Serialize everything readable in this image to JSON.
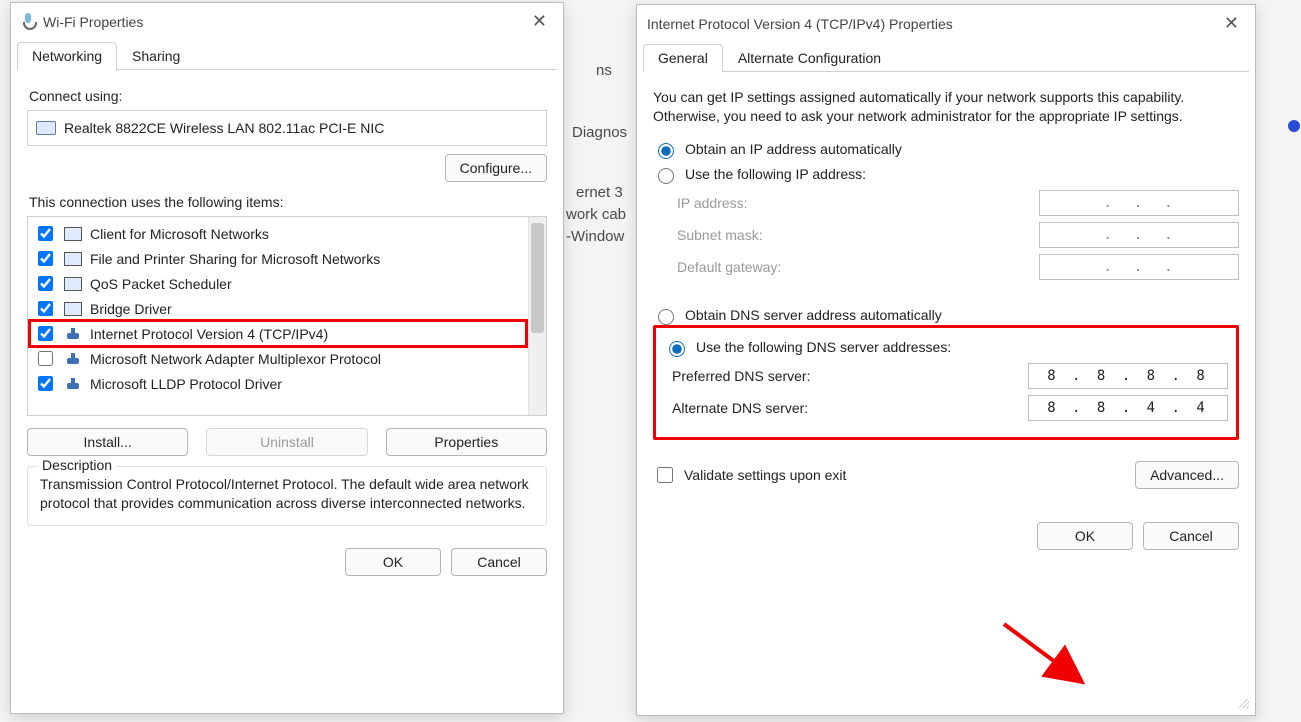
{
  "background": {
    "frag1": "ns",
    "frag2": "Diagnos",
    "frag3": "ernet 3",
    "frag4": "work cab",
    "frag5": "-Window"
  },
  "wifi": {
    "title": "Wi-Fi Properties",
    "tabs": {
      "networking": "Networking",
      "sharing": "Sharing"
    },
    "connect_using": "Connect using:",
    "adapter": "Realtek 8822CE Wireless LAN 802.11ac PCI-E NIC",
    "configure": "Configure...",
    "uses_items": "This connection uses the following items:",
    "items": [
      {
        "checked": true,
        "icon": "monitor",
        "label": "Client for Microsoft Networks",
        "hl": false
      },
      {
        "checked": true,
        "icon": "monitor",
        "label": "File and Printer Sharing for Microsoft Networks",
        "hl": false
      },
      {
        "checked": true,
        "icon": "monitor",
        "label": "QoS Packet Scheduler",
        "hl": false
      },
      {
        "checked": true,
        "icon": "monitor",
        "label": "Bridge Driver",
        "hl": false
      },
      {
        "checked": true,
        "icon": "net",
        "label": "Internet Protocol Version 4 (TCP/IPv4)",
        "hl": true
      },
      {
        "checked": false,
        "icon": "net",
        "label": "Microsoft Network Adapter Multiplexor Protocol",
        "hl": false
      },
      {
        "checked": true,
        "icon": "net",
        "label": "Microsoft LLDP Protocol Driver",
        "hl": false
      }
    ],
    "install": "Install...",
    "uninstall": "Uninstall",
    "properties": "Properties",
    "desc_legend": "Description",
    "description": "Transmission Control Protocol/Internet Protocol. The default wide area network protocol that provides communication across diverse interconnected networks.",
    "ok": "OK",
    "cancel": "Cancel"
  },
  "ipv4": {
    "title": "Internet Protocol Version 4 (TCP/IPv4) Properties",
    "tabs": {
      "general": "General",
      "alt": "Alternate Configuration"
    },
    "note": "You can get IP settings assigned automatically if your network supports this capability. Otherwise, you need to ask your network administrator for the appropriate IP settings.",
    "radio_ip_auto": "Obtain an IP address automatically",
    "radio_ip_manual": "Use the following IP address:",
    "ip_addr_label": "IP address:",
    "subnet_label": "Subnet mask:",
    "gateway_label": "Default gateway:",
    "radio_dns_auto": "Obtain DNS server address automatically",
    "radio_dns_manual": "Use the following DNS server addresses:",
    "pref_dns_label": "Preferred DNS server:",
    "alt_dns_label": "Alternate DNS server:",
    "pref_dns_value": "8 . 8 . 8 . 8",
    "alt_dns_value": "8 . 8 . 4 . 4",
    "validate": "Validate settings upon exit",
    "advanced": "Advanced...",
    "ok": "OK",
    "cancel": "Cancel"
  }
}
